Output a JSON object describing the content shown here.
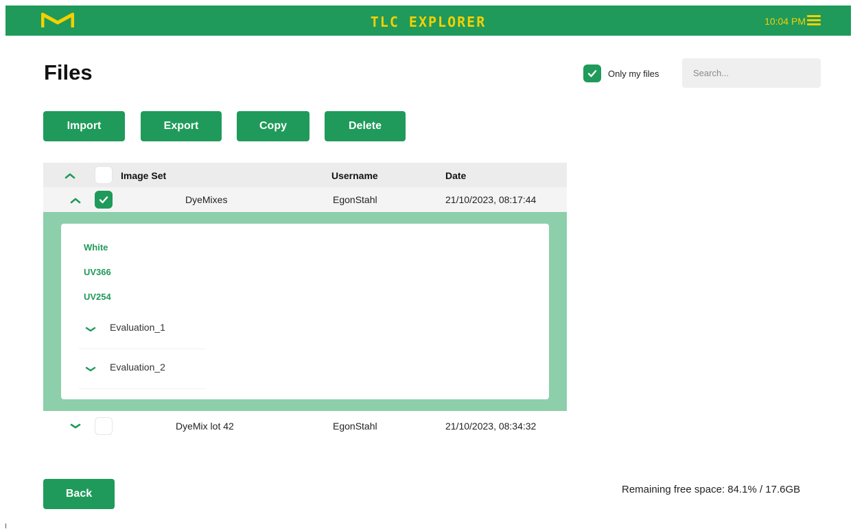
{
  "header": {
    "logo_icon": "m-logo-icon",
    "title": "TLC EXPLORER",
    "time": "10:04 PM",
    "menu_icon": "hamburger-menu-icon",
    "bar_color": "#1f9a5a",
    "accent_color": "#f5d000"
  },
  "page": {
    "title": "Files",
    "only_my_files_label": "Only my files",
    "only_my_files_checked": true,
    "search_placeholder": "Search..."
  },
  "toolbar": {
    "import": "Import",
    "export": "Export",
    "copy": "Copy",
    "delete": "Delete"
  },
  "table": {
    "columns": [
      "Image Set",
      "Username",
      "Date"
    ],
    "rows": [
      {
        "name": "DyeMixes",
        "username": "EgonStahl",
        "date": "21/10/2023, 08:17:44",
        "checked": true,
        "expanded": true,
        "channels": [
          "White",
          "UV366",
          "UV254"
        ],
        "evaluations": [
          "Evaluation_1",
          "Evaluation_2"
        ]
      },
      {
        "name": "DyeMix lot 42",
        "username": "EgonStahl",
        "date": "21/10/2023, 08:34:32",
        "checked": false,
        "expanded": false
      }
    ]
  },
  "footer": {
    "back": "Back",
    "free_space": "Remaining free space: 84.1% / 17.6GB"
  }
}
